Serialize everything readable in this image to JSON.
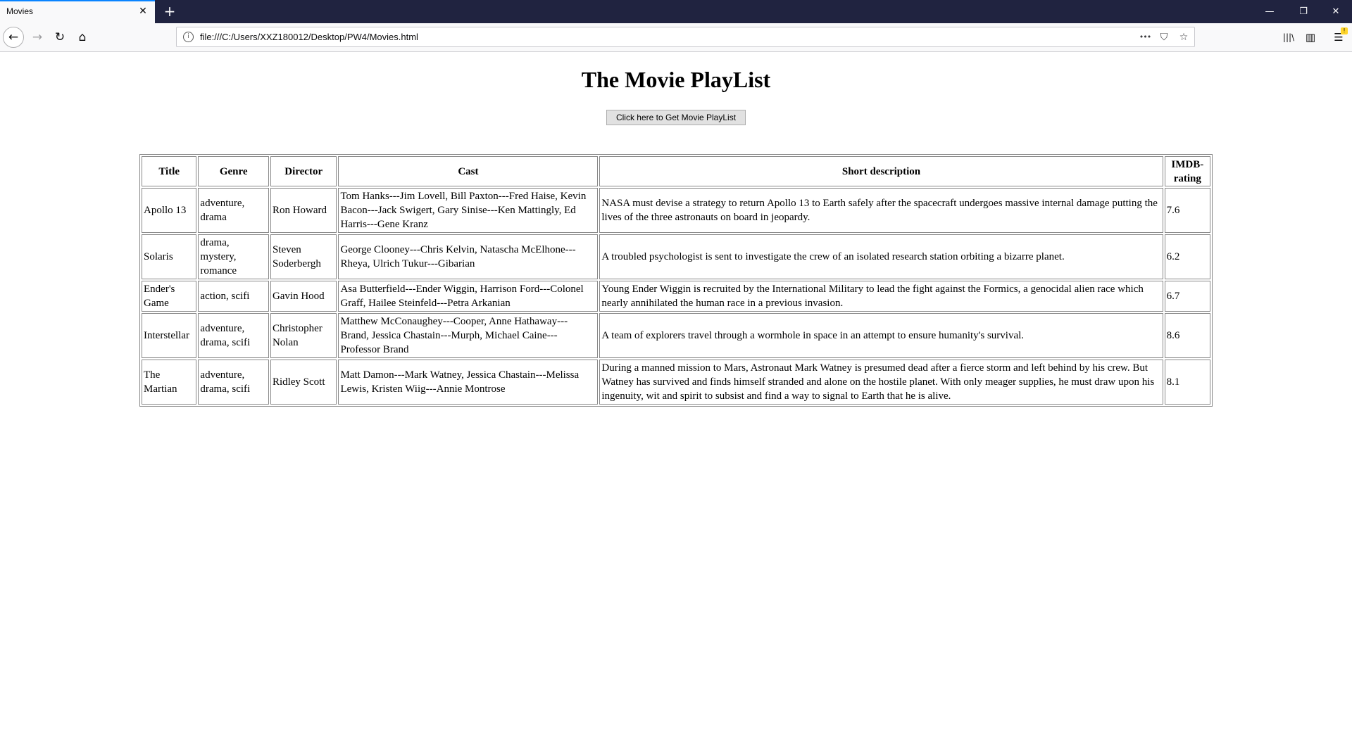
{
  "browser": {
    "tab_title": "Movies",
    "tab_close": "✕",
    "new_tab": "+",
    "url": "file:///C:/Users/XXZ180012/Desktop/PW4/Movies.html",
    "win_minimize": "—",
    "win_restore": "❐",
    "win_close": "✕",
    "icons": {
      "back": "←",
      "forward": "→",
      "reload": "↻",
      "home": "⌂",
      "info": "i",
      "more": "•••",
      "pocket": "⛉",
      "bookmark": "☆",
      "library": "|||\\",
      "sidebar": "▥",
      "menu": "☰"
    },
    "accent_color": "#0a84ff",
    "tabbar_color": "#202340"
  },
  "page": {
    "heading": "The Movie PlayList",
    "button_label": "Click here to Get Movie PlayList"
  },
  "table": {
    "headers": [
      "Title",
      "Genre",
      "Director",
      "Cast",
      "Short description",
      "IMDB-rating"
    ],
    "rows": [
      {
        "title": "Apollo 13",
        "genre": "adventure, drama",
        "director": "Ron Howard",
        "cast": "Tom Hanks---Jim Lovell, Bill Paxton---Fred Haise, Kevin Bacon---Jack Swigert, Gary Sinise---Ken Mattingly, Ed Harris---Gene Kranz",
        "description": "NASA must devise a strategy to return Apollo 13 to Earth safely after the spacecraft undergoes massive internal damage putting the lives of the three astronauts on board in jeopardy.",
        "rating": "7.6"
      },
      {
        "title": "Solaris",
        "genre": "drama, mystery, romance",
        "director": "Steven Soderbergh",
        "cast": "George Clooney---Chris Kelvin, Natascha McElhone---Rheya, Ulrich Tukur---Gibarian",
        "description": "A troubled psychologist is sent to investigate the crew of an isolated research station orbiting a bizarre planet.",
        "rating": "6.2"
      },
      {
        "title": "Ender's Game",
        "genre": "action, scifi",
        "director": "Gavin Hood",
        "cast": "Asa Butterfield---Ender Wiggin, Harrison Ford---Colonel Graff, Hailee Steinfeld---Petra Arkanian",
        "description": "Young Ender Wiggin is recruited by the International Military to lead the fight against the Formics, a genocidal alien race which nearly annihilated the human race in a previous invasion.",
        "rating": "6.7"
      },
      {
        "title": "Interstellar",
        "genre": "adventure, drama, scifi",
        "director": "Christopher Nolan",
        "cast": "Matthew McConaughey---Cooper, Anne Hathaway---Brand, Jessica Chastain---Murph, Michael Caine---Professor Brand",
        "description": "A team of explorers travel through a wormhole in space in an attempt to ensure humanity's survival.",
        "rating": "8.6"
      },
      {
        "title": "The Martian",
        "genre": "adventure, drama, scifi",
        "director": "Ridley Scott",
        "cast": "Matt Damon---Mark Watney, Jessica Chastain---Melissa Lewis, Kristen Wiig---Annie Montrose",
        "description": "During a manned mission to Mars, Astronaut Mark Watney is presumed dead after a fierce storm and left behind by his crew. But Watney has survived and finds himself stranded and alone on the hostile planet. With only meager supplies, he must draw upon his ingenuity, wit and spirit to subsist and find a way to signal to Earth that he is alive.",
        "rating": "8.1"
      }
    ]
  }
}
